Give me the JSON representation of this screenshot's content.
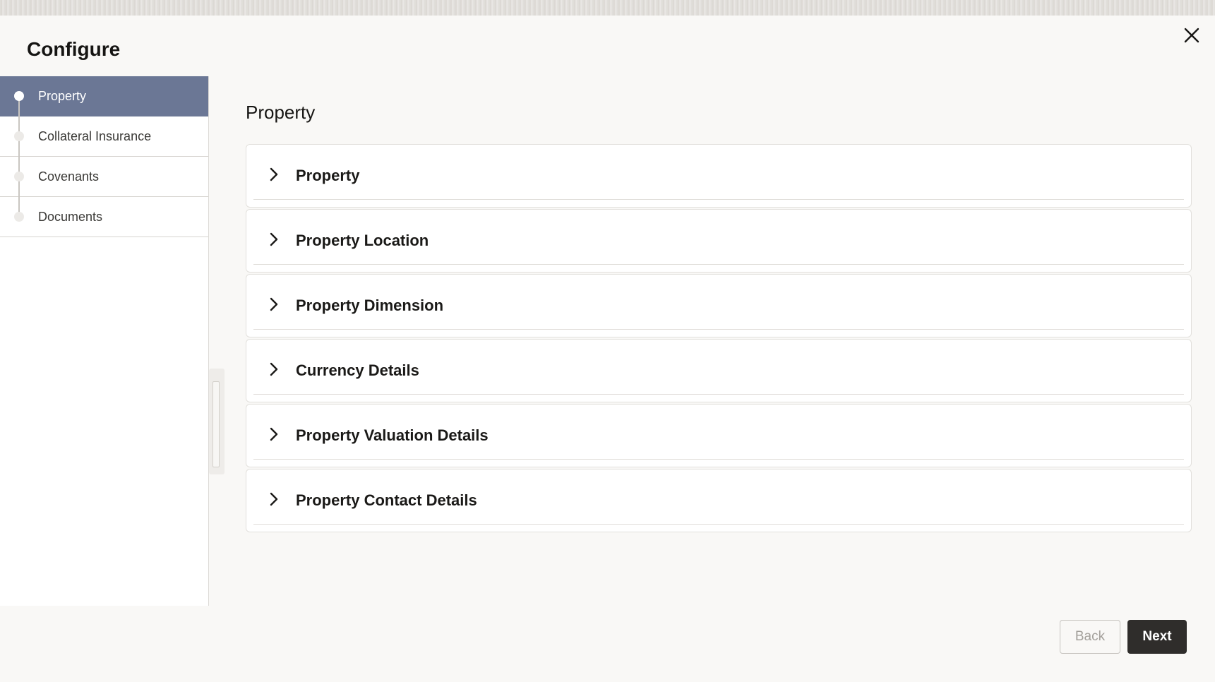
{
  "modal": {
    "title": "Configure",
    "close_icon": "close-icon"
  },
  "sidebar": {
    "steps": [
      {
        "label": "Property",
        "active": true
      },
      {
        "label": "Collateral Insurance",
        "active": false
      },
      {
        "label": "Covenants",
        "active": false
      },
      {
        "label": "Documents",
        "active": false
      }
    ]
  },
  "main": {
    "section_title": "Property",
    "panels": [
      {
        "title": "Property",
        "expanded": false,
        "icon": "chevron-right-icon"
      },
      {
        "title": "Property Location",
        "expanded": false,
        "icon": "chevron-right-icon"
      },
      {
        "title": "Property Dimension",
        "expanded": false,
        "icon": "chevron-right-icon"
      },
      {
        "title": "Currency Details",
        "expanded": false,
        "icon": "chevron-right-icon"
      },
      {
        "title": "Property Valuation Details",
        "expanded": false,
        "icon": "chevron-right-icon"
      },
      {
        "title": "Property Contact Details",
        "expanded": false,
        "icon": "chevron-right-icon"
      }
    ]
  },
  "footer": {
    "back_label": "Back",
    "next_label": "Next",
    "back_enabled": false
  },
  "colors": {
    "active_step": "#6b7795",
    "primary_button": "#2f2d2b",
    "background": "#f9f8f6"
  }
}
